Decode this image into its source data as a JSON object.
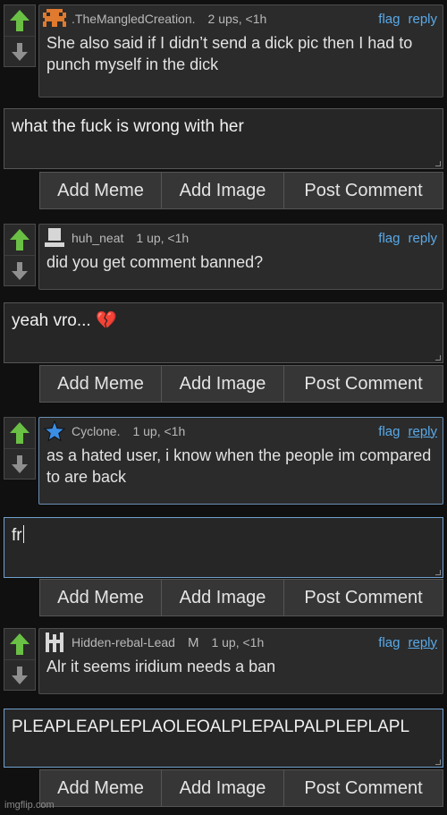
{
  "colors": {
    "upvote": "#6abf45",
    "downvote": "#8f8f8f",
    "link": "#59a9e8"
  },
  "comments": [
    {
      "username": ".TheMangledCreation.",
      "badge": "",
      "stats": "2 ups, <1h",
      "avatar_icon": "pixel-creature-icon",
      "flag": "flag",
      "reply": "reply",
      "text": "She also said if I didn’t send a dick pic then I had to punch myself in the dick"
    },
    {
      "username": "huh_neat",
      "badge": "",
      "stats": "1 up, <1h",
      "avatar_icon": "blank-avatar-icon",
      "flag": "flag",
      "reply": "reply",
      "text": "did you get comment banned?"
    },
    {
      "username": "Cyclone.",
      "badge": "",
      "stats": "1 up, <1h",
      "avatar_icon": "blue-star-icon",
      "flag": "flag",
      "reply": "reply",
      "text": "as a hated user, i know when the people im compared to are back"
    },
    {
      "username": "Hidden-rebal-Lead",
      "badge": "M",
      "stats": "1 up, <1h",
      "avatar_icon": "glyph-avatar-icon",
      "flag": "flag",
      "reply": "reply",
      "text": "Alr it seems iridium needs a ban"
    }
  ],
  "replies": [
    "what the fuck is wrong with her",
    "yeah vro... 💔",
    "fr",
    "PLEAPLEAPLEPLAOLEOALPLEPALPALPLEPLAPL"
  ],
  "buttons": {
    "add_meme": "Add Meme",
    "add_image": "Add Image",
    "post_comment": "Post Comment"
  },
  "watermark": "imgflip.com"
}
